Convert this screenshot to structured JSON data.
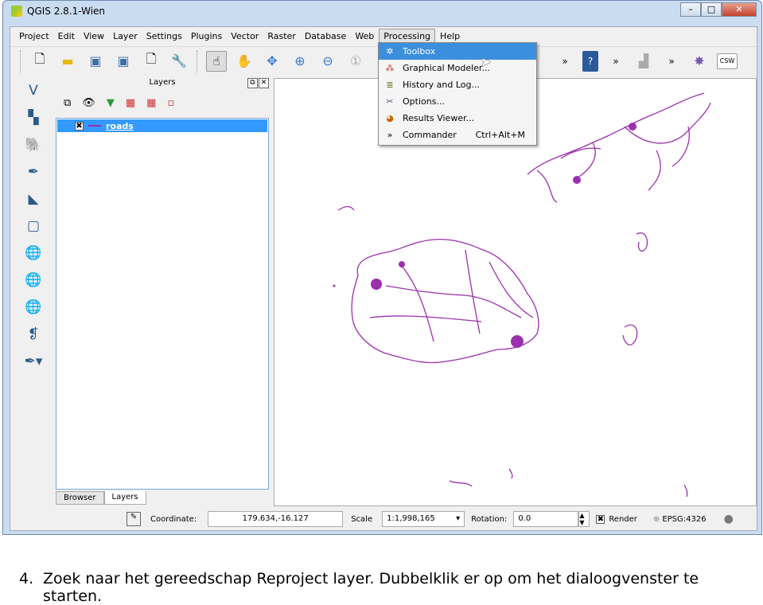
{
  "window": {
    "title": "QGIS 2.8.1-Wien"
  },
  "menubar": [
    "Project",
    "Edit",
    "View",
    "Layer",
    "Settings",
    "Plugins",
    "Vector",
    "Raster",
    "Database",
    "Web",
    "Processing",
    "Help"
  ],
  "processing_menu": [
    {
      "label": "Toolbox",
      "icon": "toolbox-gear-icon",
      "shortcut": ""
    },
    {
      "label": "Graphical Modeler...",
      "icon": "modeler-icon",
      "shortcut": ""
    },
    {
      "label": "History and Log...",
      "icon": "history-icon",
      "shortcut": ""
    },
    {
      "label": "Options...",
      "icon": "options-tools-icon",
      "shortcut": ""
    },
    {
      "label": "Results Viewer...",
      "icon": "results-icon",
      "shortcut": ""
    },
    {
      "label": "Commander",
      "icon": "chevrons-icon",
      "shortcut": "Ctrl+Alt+M"
    }
  ],
  "layers_panel": {
    "title": "Layers",
    "layers": [
      {
        "name": "roads",
        "checked": true,
        "color": "#9b2fae"
      }
    ],
    "tabs": [
      "Browser",
      "Layers"
    ],
    "active_tab": "Layers"
  },
  "toolbar": {
    "csw": "CSW",
    "help": "?"
  },
  "status": {
    "coordinate_label": "Coordinate:",
    "coordinate": "179.634,-16.127",
    "scale_label": "Scale",
    "scale": "1:1,998,165",
    "rotation_label": "Rotation:",
    "rotation": "0.0",
    "render_label": "Render",
    "render_checked": true,
    "crs": "EPSG:4326"
  },
  "caption": {
    "number": "4.",
    "text": "Zoek naar het gereedschap Reproject layer. Dubbelklik er op om het dialoogvenster te",
    "text2": "starten."
  },
  "colors": {
    "accent": "#3399ff",
    "roads": "#9b2fae",
    "menu_highlight": "#3b8fdc"
  }
}
